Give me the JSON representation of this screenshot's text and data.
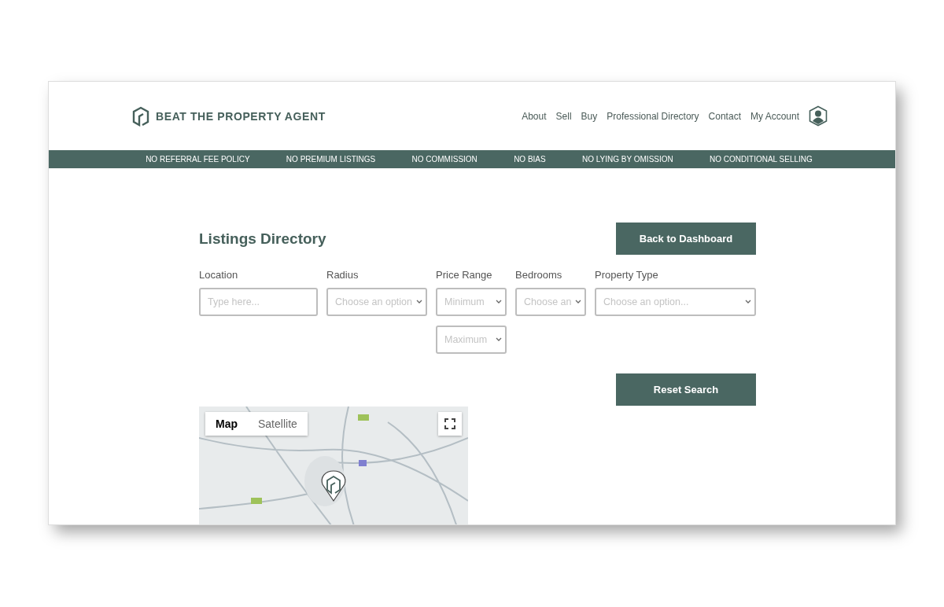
{
  "header": {
    "logo_text": "BEAT THE PROPERTY AGENT",
    "nav": [
      "About",
      "Sell",
      "Buy",
      "Professional Directory",
      "Contact",
      "My Account"
    ]
  },
  "banner": [
    "NO REFERRAL FEE POLICY",
    "NO PREMIUM LISTINGS",
    "NO COMMISSION",
    "NO BIAS",
    "NO LYING BY OMISSION",
    "NO CONDITIONAL SELLING"
  ],
  "page": {
    "title": "Listings Directory",
    "back_button": "Back to Dashboard",
    "reset_button": "Reset Search"
  },
  "filters": [
    {
      "label": "Location",
      "kind": "text",
      "fields": [
        {
          "placeholder": "Type here..."
        }
      ]
    },
    {
      "label": "Radius",
      "kind": "select",
      "fields": [
        {
          "placeholder": "Choose an option"
        }
      ]
    },
    {
      "label": "Price Range",
      "kind": "select",
      "fields": [
        {
          "placeholder": "Minimum"
        },
        {
          "placeholder": "Maximum"
        }
      ]
    },
    {
      "label": "Bedrooms",
      "kind": "select",
      "fields": [
        {
          "placeholder": "Choose an"
        }
      ]
    },
    {
      "label": "Property Type",
      "kind": "select",
      "fields": [
        {
          "placeholder": "Choose an option..."
        }
      ]
    }
  ],
  "map": {
    "view_tabs": [
      {
        "label": "Map",
        "selected": true
      },
      {
        "label": "Satellite",
        "selected": false
      }
    ]
  }
}
